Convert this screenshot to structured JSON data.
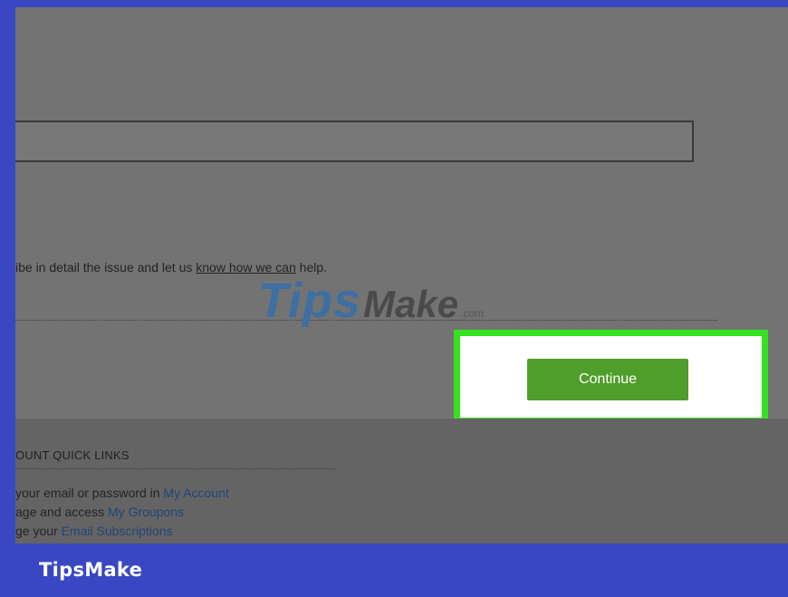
{
  "form": {
    "help_text_pre": "ibe in detail the issue and let us ",
    "help_text_link": "know how we can",
    "help_text_post": " help."
  },
  "watermark": {
    "part1": "Tips",
    "part2": "Make",
    "part3": ".com"
  },
  "continue_button": {
    "label": "Continue"
  },
  "quick_links": {
    "title": "OUNT QUICK LINKS",
    "rows": [
      {
        "pre": "your email or password in ",
        "link": "My Account"
      },
      {
        "pre": "age and access ",
        "link": "My Groupons"
      },
      {
        "pre": "ge your ",
        "link": "Email Subscriptions"
      }
    ]
  },
  "brand": {
    "name": "TipsMake"
  },
  "colors": {
    "frame_blue": "#3a47c2",
    "highlight_green": "#35e21f",
    "button_green": "#4f9d2a",
    "overlay_gray": "#737373"
  }
}
